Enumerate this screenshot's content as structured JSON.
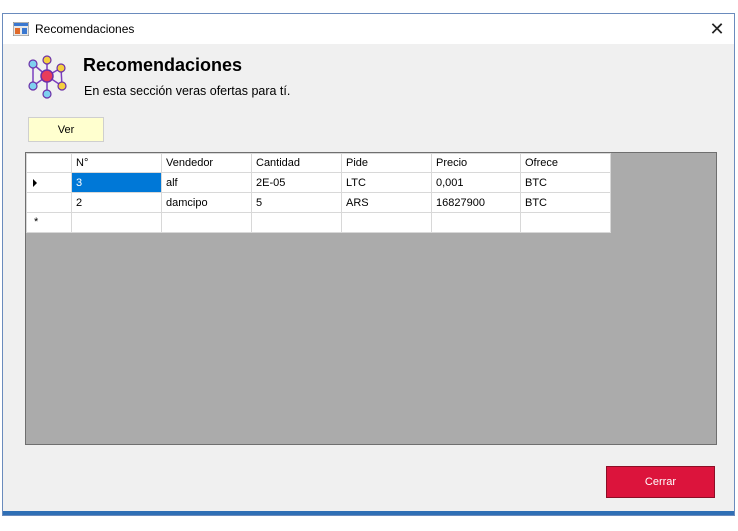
{
  "window": {
    "title": "Recomendaciones",
    "close_glyph": "✕"
  },
  "header": {
    "title": "Recomendaciones",
    "subtitle": "En esta sección veras ofertas para tí."
  },
  "toolbar": {
    "ver_label": "Ver"
  },
  "table": {
    "columns": [
      "N°",
      "Vendedor",
      "Cantidad",
      "Pide",
      "Precio",
      "Ofrece"
    ],
    "rows": [
      [
        "3",
        "alf",
        "2E-05",
        "LTC",
        "0,001",
        "BTC"
      ],
      [
        "2",
        "damcipo",
        "5",
        "ARS",
        "16827900",
        "BTC"
      ]
    ],
    "new_row_marker": "*"
  },
  "footer": {
    "cerrar_label": "Cerrar"
  },
  "colors": {
    "ver_button_bg": "#ffffcf",
    "cerrar_button_bg": "#dc143c",
    "selected_cell_bg": "#0078d7",
    "grid_bg": "#ababab"
  }
}
